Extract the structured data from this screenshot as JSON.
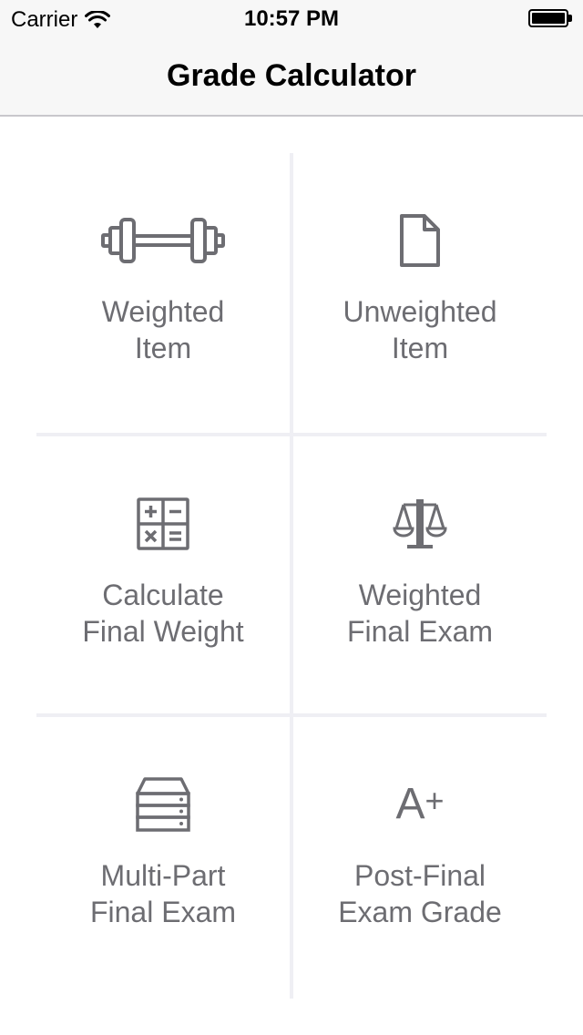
{
  "status_bar": {
    "carrier": "Carrier",
    "time": "10:57 PM",
    "wifi_icon": "wifi-icon",
    "battery_icon": "battery-icon"
  },
  "nav": {
    "title": "Grade Calculator"
  },
  "menu": {
    "items": [
      {
        "label": "Weighted\nItem",
        "icon": "barbell-icon"
      },
      {
        "label": "Unweighted\nItem",
        "icon": "document-icon"
      },
      {
        "label": "Calculate\nFinal Weight",
        "icon": "calculator-icon"
      },
      {
        "label": "Weighted\nFinal Exam",
        "icon": "scale-icon"
      },
      {
        "label": "Multi-Part\nFinal Exam",
        "icon": "stack-icon"
      },
      {
        "label": "Post-Final\nExam Grade",
        "icon": "a-plus-icon"
      }
    ],
    "a_plus_text": "A",
    "a_plus_sup": "+"
  },
  "colors": {
    "icon": "#6d6d72",
    "label": "#6d6d72",
    "divider": "#efeff4",
    "navbar_bg": "#f7f7f7"
  }
}
